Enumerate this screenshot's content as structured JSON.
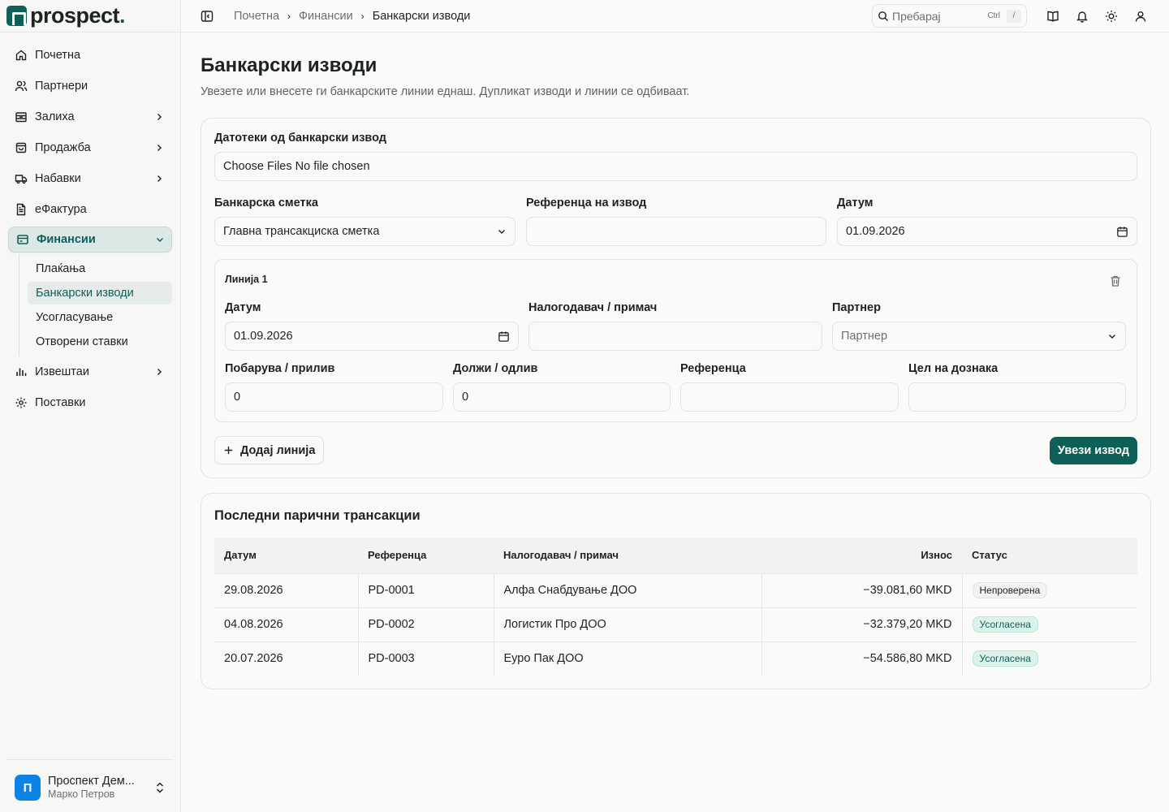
{
  "brand": {
    "name": "prospect",
    "dot": "."
  },
  "sidebar": {
    "items": [
      {
        "label": "Почетна",
        "icon": "home-icon"
      },
      {
        "label": "Партнери",
        "icon": "users-icon"
      },
      {
        "label": "Залиха",
        "icon": "inventory-icon"
      },
      {
        "label": "Продажба",
        "icon": "shopping-bag-icon"
      },
      {
        "label": "Набавки",
        "icon": "truck-icon"
      },
      {
        "label": "еФактура",
        "icon": "document-icon"
      },
      {
        "label": "Финансии",
        "icon": "wallet-icon"
      },
      {
        "label": "Извештаи",
        "icon": "bar-chart-icon"
      },
      {
        "label": "Поставки",
        "icon": "gear-icon"
      }
    ],
    "finance_sub": [
      "Плаќања",
      "Банкарски изводи",
      "Усогласување",
      "Отворени ставки"
    ]
  },
  "account": {
    "initial": "П",
    "name": "Проспект Дем...",
    "user": "Марко Петров"
  },
  "topbar": {
    "breadcrumb": [
      "Почетна",
      "Финансии",
      "Банкарски изводи"
    ],
    "search_placeholder": "Пребарај",
    "kbd_ctrl": "Ctrl",
    "kbd_slash": "/"
  },
  "page": {
    "title": "Банкарски изводи",
    "subtitle": "Увезете или внесете ги банкарските линии еднаш. Дупликат изводи и линии се одбиваат."
  },
  "form": {
    "files_label": "Датотеки од банкарски извод",
    "file_button": "Choose Files",
    "file_status": "No file chosen",
    "account_label": "Банкарска сметка",
    "account_value": "Главна трансакциска сметка",
    "reference_label": "Референца на извод",
    "reference_value": "",
    "date_label": "Датум",
    "date_value": "01.09.2026",
    "line": {
      "title": "Линија 1",
      "date_label": "Датум",
      "date_value": "01.09.2026",
      "payer_label": "Налогодавач / примач",
      "payer_value": "",
      "partner_label": "Партнер",
      "partner_placeholder": "Партнер",
      "credit_label": "Побарува / прилив",
      "credit_value": "0",
      "debit_label": "Должи / одлив",
      "debit_value": "0",
      "ref_label": "Референца",
      "ref_value": "",
      "purpose_label": "Цел на дознака",
      "purpose_value": ""
    },
    "add_line": "Додај линија",
    "import": "Увези извод"
  },
  "transactions": {
    "title": "Последни парични трансакции",
    "columns": [
      "Датум",
      "Референца",
      "Налогодавач / примач",
      "Износ",
      "Статус"
    ],
    "rows": [
      {
        "date": "29.08.2026",
        "ref": "PD-0001",
        "party": "Алфа Снабдување ДОО",
        "amount": "−39.081,60 MKD",
        "status": "Непроверена",
        "ok": false
      },
      {
        "date": "04.08.2026",
        "ref": "PD-0002",
        "party": "Логистик Про ДОО",
        "amount": "−32.379,20 MKD",
        "status": "Усогласена",
        "ok": true
      },
      {
        "date": "20.07.2026",
        "ref": "PD-0003",
        "party": "Еуро Пак ДОО",
        "amount": "−54.586,80 MKD",
        "status": "Усогласена",
        "ok": true
      }
    ]
  },
  "colors": {
    "accent": "#0e5f57",
    "avatar": "#0b84e6"
  }
}
